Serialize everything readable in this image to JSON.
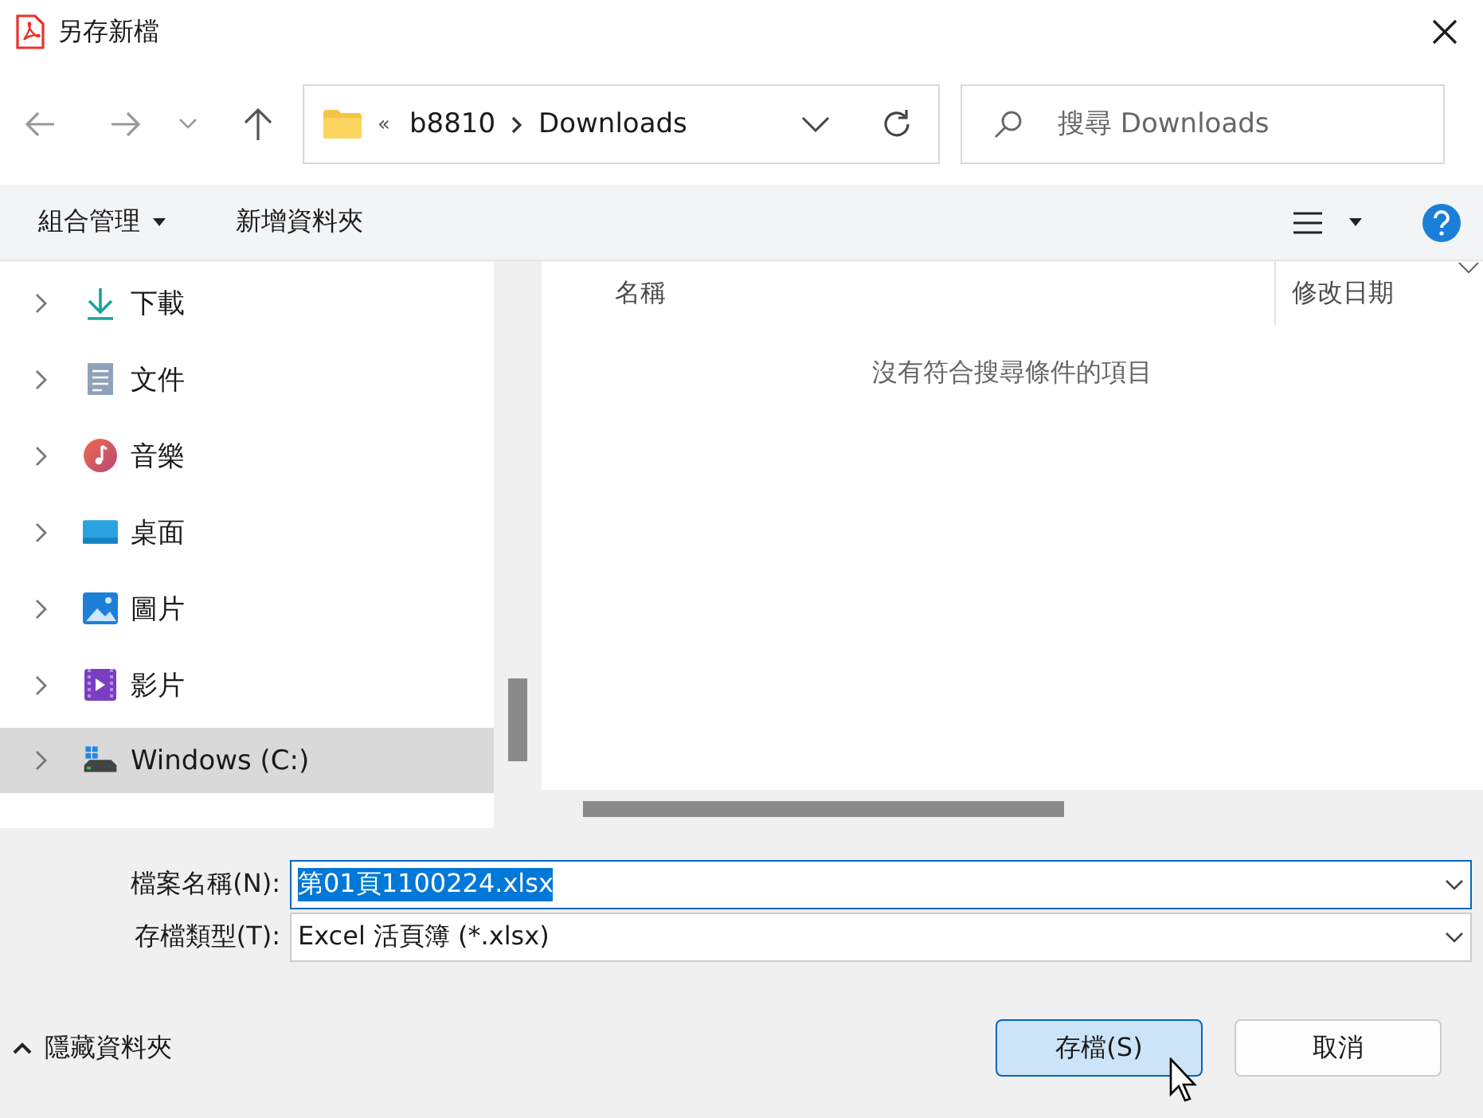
{
  "window": {
    "title": "另存新檔"
  },
  "nav": {
    "overflow": "«",
    "path": [
      "b8810",
      "Downloads"
    ]
  },
  "search": {
    "placeholder": "搜尋 Downloads"
  },
  "toolbar": {
    "organize": "組合管理",
    "new_folder": "新增資料夾"
  },
  "sidebar": {
    "items": [
      {
        "label": "下載",
        "kind": "download",
        "selected": false
      },
      {
        "label": "文件",
        "kind": "document",
        "selected": false
      },
      {
        "label": "音樂",
        "kind": "music",
        "selected": false
      },
      {
        "label": "桌面",
        "kind": "desktop",
        "selected": false
      },
      {
        "label": "圖片",
        "kind": "pictures",
        "selected": false
      },
      {
        "label": "影片",
        "kind": "videos",
        "selected": false
      },
      {
        "label": "Windows (C:)",
        "kind": "drive",
        "selected": true
      }
    ]
  },
  "columns": [
    "名稱",
    "修改日期"
  ],
  "empty_message": "沒有符合搜尋條件的項目",
  "form": {
    "filename": {
      "label": "檔案名稱(N):",
      "value": "第01頁1100224.xlsx",
      "highlighted": true
    },
    "filetype": {
      "label": "存檔類型(T):",
      "value": "Excel 活頁簿 (*.xlsx)"
    }
  },
  "hide_folders": "隱藏資料夾",
  "buttons": [
    {
      "label": "存檔(S)",
      "kind": "primary"
    },
    {
      "label": "取消",
      "kind": "secondary"
    }
  ]
}
